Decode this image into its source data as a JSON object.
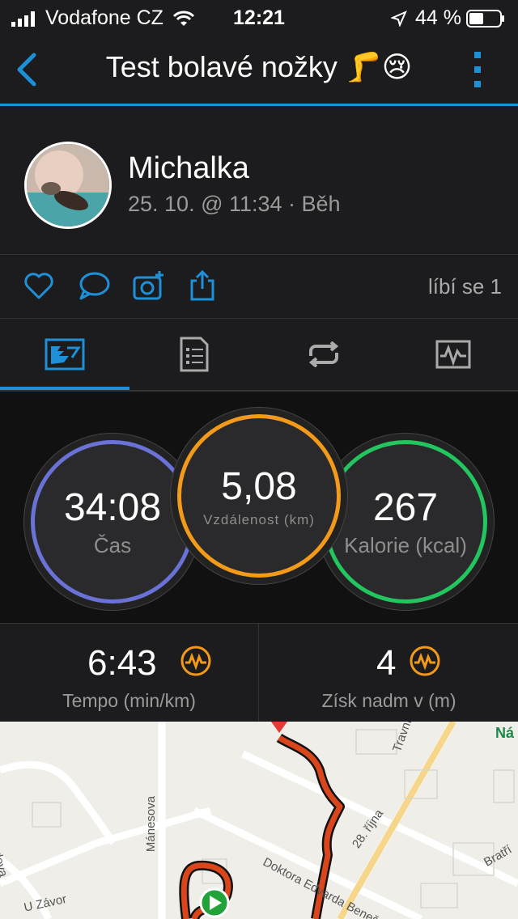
{
  "status_bar": {
    "carrier": "Vodafone CZ",
    "time": "12:21",
    "battery": "44 %"
  },
  "nav": {
    "title": "Test bolavé nožky 🦵😢"
  },
  "profile": {
    "name": "Michalka",
    "meta": "25. 10. @ 11:34 · Běh"
  },
  "actions": {
    "likes": "líbí se 1"
  },
  "stats": [
    {
      "value": "34:08",
      "label": "Čas",
      "color": "#4a90e2"
    },
    {
      "value": "5,08",
      "label": "Vzdálenost (km)",
      "color": "#f39a1a"
    },
    {
      "value": "267",
      "label": "Kalorie (kcal)",
      "color": "#22c55e"
    }
  ],
  "metrics": [
    {
      "value": "6:43",
      "label": "Tempo (min/km)"
    },
    {
      "value": "4",
      "label": "Získ nadm v (m)"
    }
  ],
  "map": {
    "streets": [
      "Mánesova",
      "Doktora Edvarda Beneše",
      "28. října",
      "Bratří",
      "Travní",
      "U Závor",
      "udova",
      "Ná"
    ]
  },
  "colors": {
    "accent": "#1e90d8",
    "metric_icon": "#f39a1a",
    "route": "#d9461c"
  }
}
